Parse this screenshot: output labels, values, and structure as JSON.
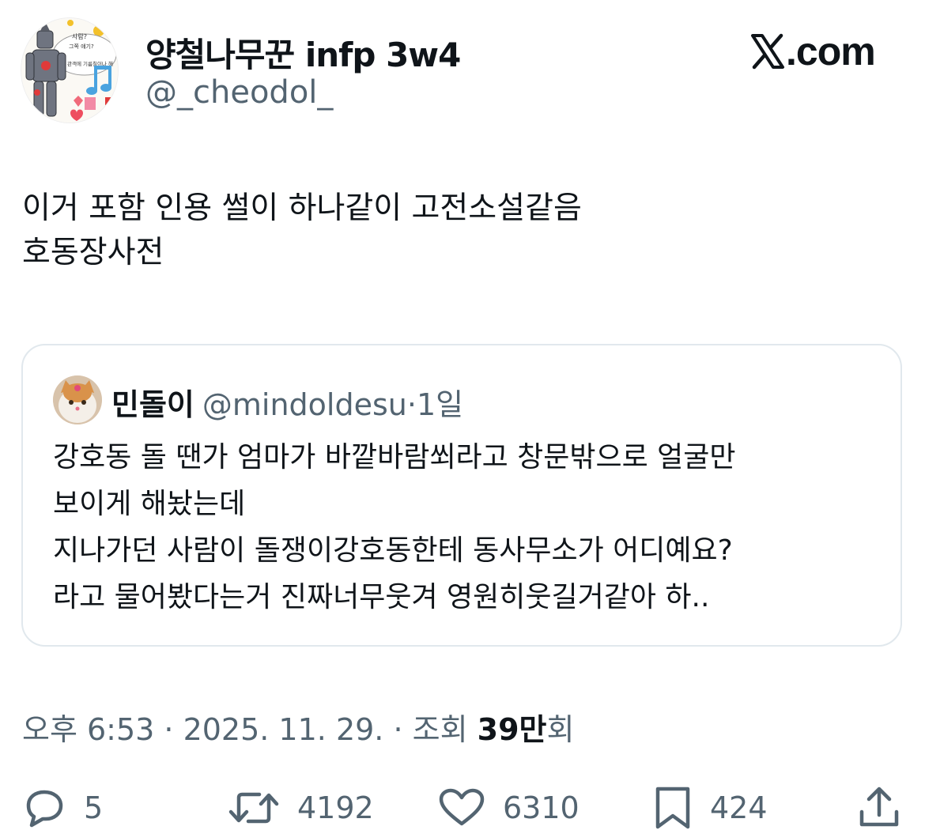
{
  "header": {
    "display_name": "양철나무꾼 infp 3w4",
    "handle": "@_cheodol_",
    "brand": ".com",
    "brand_icon": "x-logo-icon"
  },
  "avatar": {
    "icon": "tin-man-collage-avatar",
    "lettering": [
      "사람?",
      "그쪽 얘기?",
      "관객에 기름칠이나 해"
    ]
  },
  "tweet": {
    "lines": [
      "이거 포함 인용 썰이 하나같이 고전소설같음",
      "호동장사전"
    ]
  },
  "quote": {
    "name": "민돌이",
    "handle": "@mindoldesu",
    "separator": "·",
    "time": "1일",
    "avatar_icon": "cat-avatar",
    "lines": [
      "강호동 돌 땐가 엄마가 바깥바람쐬라고 창문밖으로 얼굴만",
      "보이게 해놨는데",
      "지나가던 사람이 돌쟁이강호동한테 동사무소가 어디예요?",
      "라고 물어봤다는거 진짜너무웃겨 영원히웃길거같아  하.."
    ]
  },
  "meta": {
    "time_date": "오후 6:53 · 2025. 11. 29. · 조회 ",
    "views_number": "39만",
    "views_suffix": "회"
  },
  "actions": {
    "replies": "5",
    "retweets": "4192",
    "likes": "6310",
    "bookmarks": "424"
  },
  "colors": {
    "text_primary": "#0f1419",
    "text_secondary": "#536471",
    "card_border": "#e1e8ed"
  }
}
